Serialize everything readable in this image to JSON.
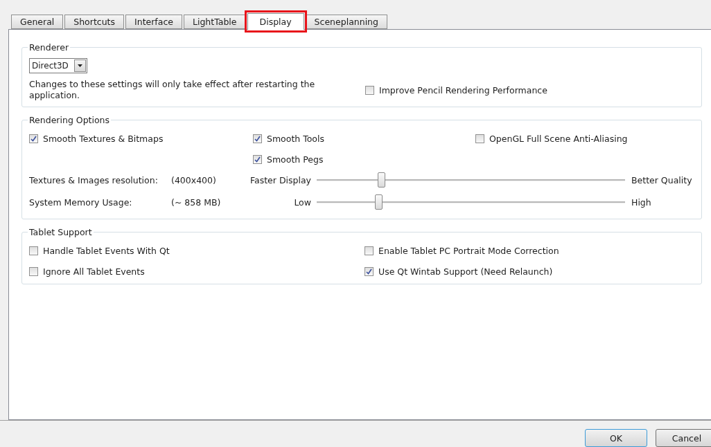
{
  "tabs": [
    {
      "label": "General",
      "selected": false
    },
    {
      "label": "Shortcuts",
      "selected": false
    },
    {
      "label": "Interface",
      "selected": false
    },
    {
      "label": "LightTable",
      "selected": false
    },
    {
      "label": "Display",
      "selected": true
    },
    {
      "label": "Sceneplanning",
      "selected": false
    }
  ],
  "renderer": {
    "title": "Renderer",
    "dropdown": {
      "value": "Direct3D"
    },
    "note": "Changes to these settings will only take effect after restarting the application.",
    "checkbox": {
      "label": "Improve Pencil Rendering Performance",
      "checked": false
    }
  },
  "rendering_options": {
    "title": "Rendering Options",
    "columns": [
      [
        {
          "label": "Smooth Textures & Bitmaps",
          "checked": true
        }
      ],
      [
        {
          "label": "Smooth Tools",
          "checked": true
        },
        {
          "label": "Smooth Pegs",
          "checked": true
        }
      ],
      [
        {
          "label": "OpenGL Full Scene Anti-Aliasing",
          "checked": false
        }
      ]
    ],
    "sliders": [
      {
        "label": "Textures & Images resolution:",
        "reading": "(400x400)",
        "min_label": "Faster Display",
        "max_label": "Better Quality",
        "level": 0.21
      },
      {
        "label": "System Memory Usage:",
        "reading": "(~ 858 MB)",
        "min_label": "Low",
        "max_label": "High",
        "level": 0.2
      }
    ]
  },
  "tablet_support": {
    "title": "Tablet Support",
    "columns": [
      [
        {
          "label": "Handle Tablet Events With Qt",
          "checked": false
        },
        {
          "label": "Ignore All Tablet Events",
          "checked": false
        }
      ],
      [
        {
          "label": "Enable Tablet PC Portrait Mode Correction",
          "checked": false
        },
        {
          "label": "Use Qt Wintab Support (Need Relaunch)",
          "checked": true
        }
      ]
    ]
  },
  "buttons": [
    {
      "label": "OK",
      "default": true
    },
    {
      "label": "Cancel",
      "default": false
    }
  ]
}
